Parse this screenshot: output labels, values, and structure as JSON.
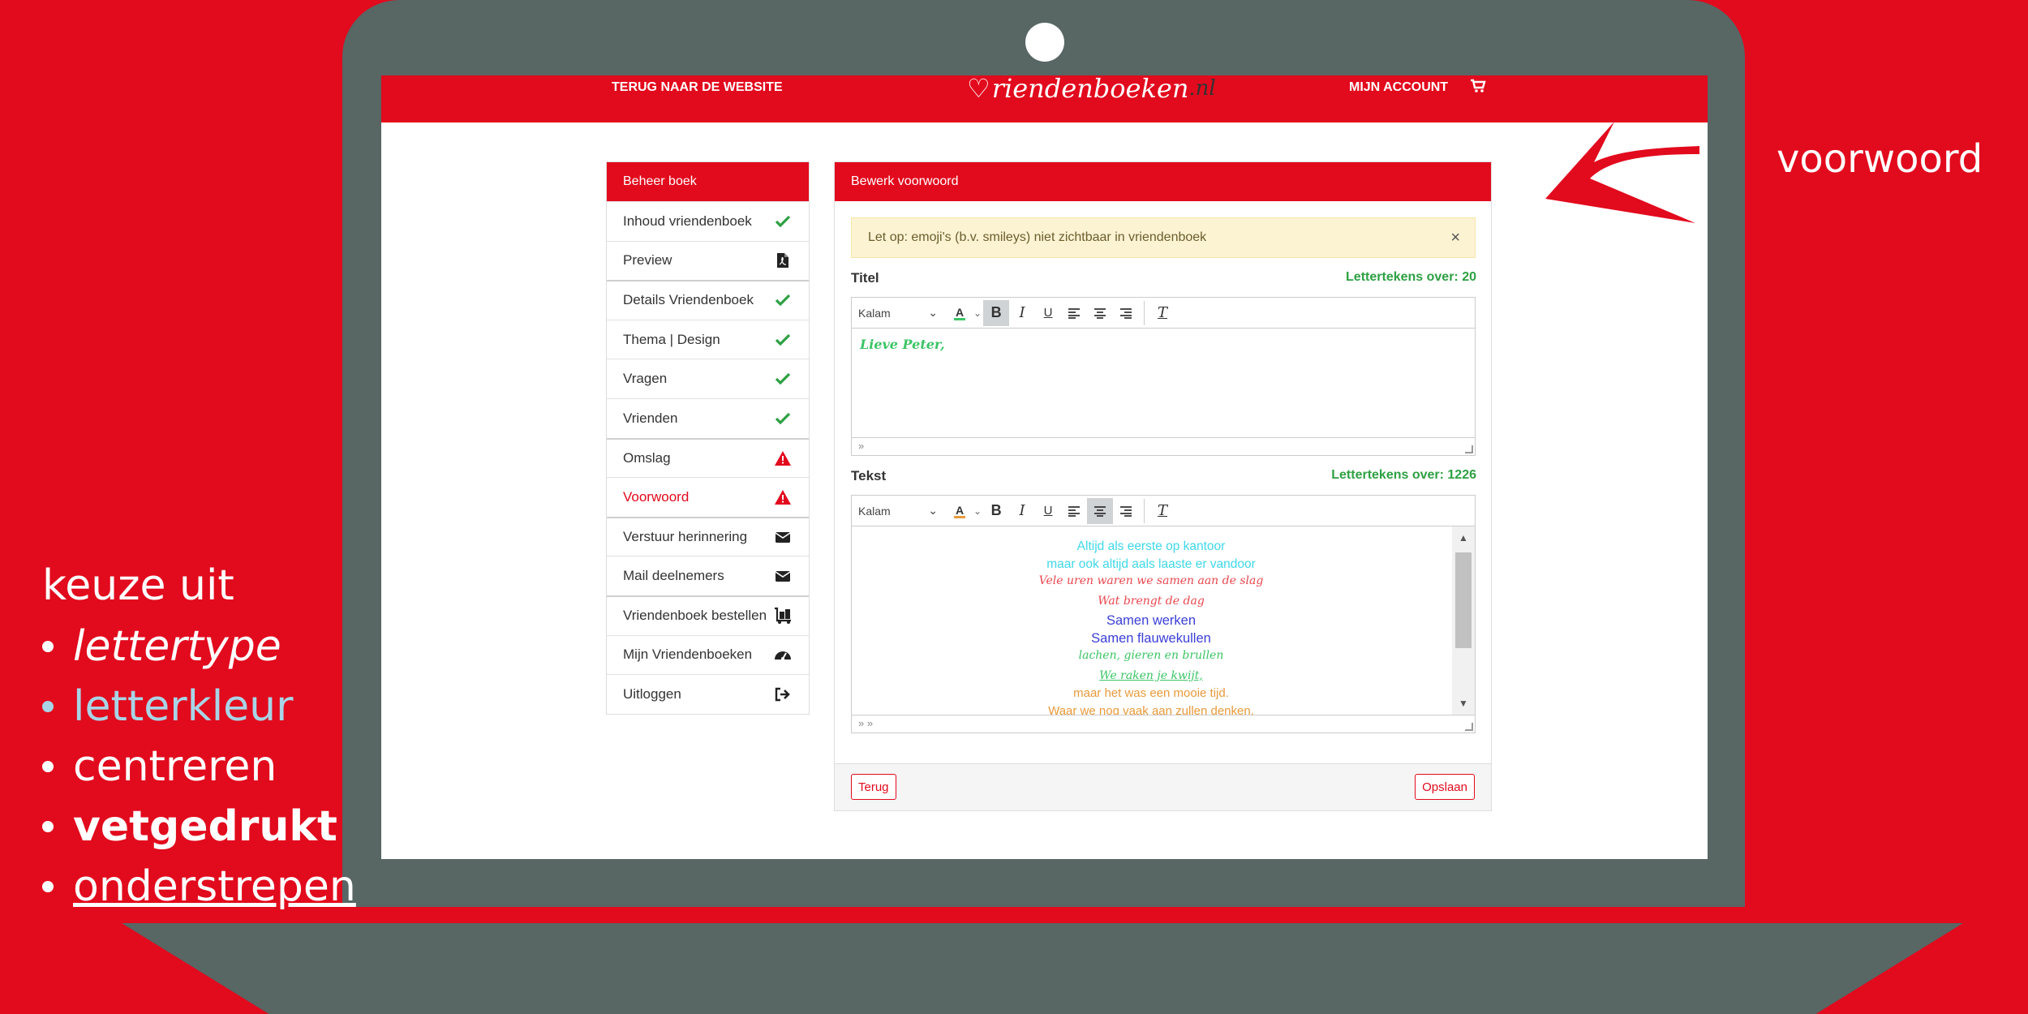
{
  "topbar": {
    "back_link": "TERUG NAAR DE WEBSITE",
    "logo_text": "riendenboeken",
    "logo_suffix": ".nl",
    "account": "MIJN ACCOUNT"
  },
  "sidebar": {
    "header": "Beheer boek",
    "items": [
      {
        "label": "Inhoud vriendenboek",
        "icon": "check-icon"
      },
      {
        "label": "Preview",
        "icon": "pdf-file-icon"
      },
      {
        "label": "Details Vriendenboek",
        "icon": "check-icon"
      },
      {
        "label": "Thema | Design",
        "icon": "check-icon"
      },
      {
        "label": "Vragen",
        "icon": "check-icon"
      },
      {
        "label": "Vrienden",
        "icon": "check-icon"
      },
      {
        "label": "Omslag",
        "icon": "warning-icon"
      },
      {
        "label": "Voorwoord",
        "icon": "warning-icon"
      },
      {
        "label": "Verstuur herinnering",
        "icon": "envelope-icon"
      },
      {
        "label": "Mail deelnemers",
        "icon": "envelope-icon"
      },
      {
        "label": "Vriendenboek bestellen",
        "icon": "luggage-cart-icon"
      },
      {
        "label": "Mijn Vriendenboeken",
        "icon": "dashboard-icon"
      },
      {
        "label": "Uitloggen",
        "icon": "sign-out-icon"
      }
    ]
  },
  "panel": {
    "header": "Bewerk voorwoord",
    "alert": "Let op: emoji's (b.v. smileys) niet zichtbaar in vriendenboek",
    "alert_close": "×",
    "titel": {
      "label": "Titel",
      "counter": "Lettertekens over: 20",
      "font": "Kalam",
      "content": "Lieve Peter,",
      "status": "»"
    },
    "tekst": {
      "label": "Tekst",
      "counter": "Lettertekens over: 1226",
      "font": "Kalam",
      "status": "» »",
      "lines": [
        {
          "text": "Altijd als eerste op kantoor",
          "color": "#3fd8e8"
        },
        {
          "text": "maar ook altijd aals laaste er vandoor",
          "color": "#3fd8e8"
        },
        {
          "text": "Vele uren waren we samen aan de slag",
          "color": "#e8474f"
        },
        {
          "text": "Wat brengt de dag",
          "color": "#e8474f"
        },
        {
          "text": "Samen werken",
          "color": "#3a3fd6"
        },
        {
          "text": "Samen flauwekullen",
          "color": "#3a3fd6"
        },
        {
          "text": "lachen, gieren en brullen",
          "color": "#3cc466"
        },
        {
          "text": "We raken je kwijt,",
          "color": "#3cc466"
        },
        {
          "text": "maar het was een mooie tijd.",
          "color": "#e89a3a"
        },
        {
          "text": "Waar we nog vaak aan zullen denken.",
          "color": "#e89a3a"
        }
      ]
    },
    "back_button": "Terug",
    "save_button": "Opslaan"
  },
  "annotations": {
    "voorwoord": "voorwoord",
    "list_head": "keuze uit",
    "items": [
      "lettertype",
      "letterkleur",
      "centreren",
      "vetgedrukt",
      "onderstrepen"
    ]
  },
  "colors": {
    "brand_red": "#e20a1d",
    "laptop_gray": "#586664",
    "success_green": "#2ea043",
    "warning_red": "#e20a1d"
  }
}
